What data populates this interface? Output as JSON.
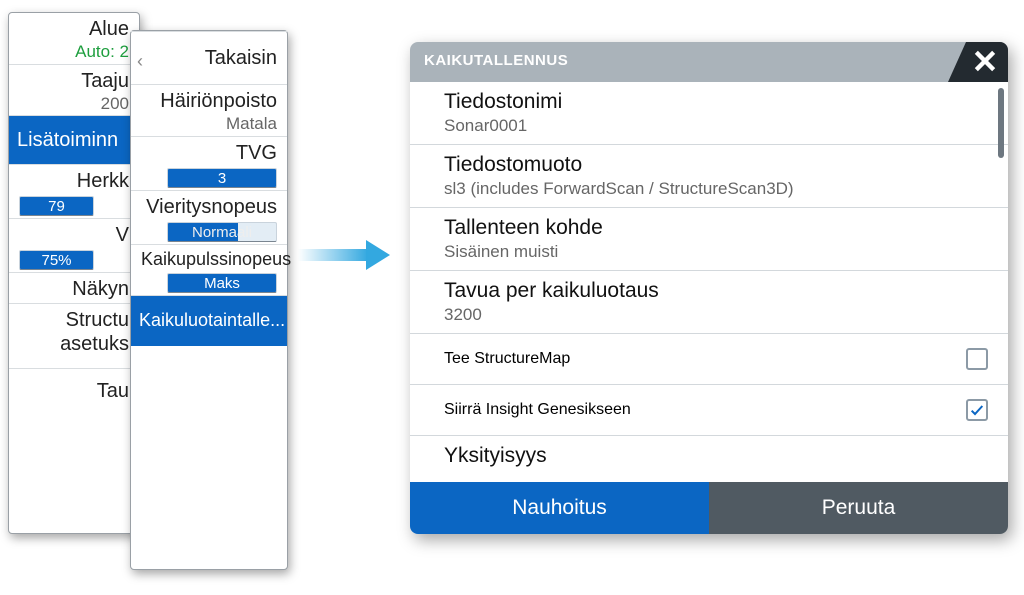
{
  "back_panel": {
    "alue": {
      "label": "Alue",
      "sub": "Auto: 2"
    },
    "taaju": {
      "label": "Taaju",
      "sub": "200"
    },
    "lisatoiminn": {
      "label": "Lisätoiminn"
    },
    "herkk": {
      "label": "Herkk",
      "chip": "79"
    },
    "v": {
      "label": "V",
      "chip": "75%"
    },
    "nakym": {
      "label": "Näkyn"
    },
    "struct": {
      "line1": "Structu",
      "line2": "asetuks"
    },
    "tau": {
      "label": "Tau"
    }
  },
  "front_panel": {
    "back": "Takaisin",
    "hairion": {
      "label": "Häiriönpoisto",
      "sub": "Matala"
    },
    "tvg": {
      "label": "TVG",
      "chip": "3"
    },
    "vieritys": {
      "label": "Vieritysnopeus",
      "chip": "Normaali"
    },
    "kaikupulssi": {
      "label": "Kaikupulssinopeus",
      "chip": "Maks"
    },
    "kaikuluot": {
      "label": "Kaikuluotaintalle..."
    }
  },
  "dialog": {
    "title": "KAIKUTALLENNUS",
    "rows": {
      "filename": {
        "label": "Tiedostonimi",
        "value": "Sonar0001"
      },
      "format": {
        "label": "Tiedostomuoto",
        "value": "sl3 (includes ForwardScan / StructureScan3D)"
      },
      "dest": {
        "label": "Tallenteen kohde",
        "value": "Sisäinen muisti"
      },
      "bytes": {
        "label": "Tavua per kaikuluotaus",
        "value": "3200"
      },
      "structmap": {
        "label": "Tee StructureMap"
      },
      "insight": {
        "label": "Siirrä Insight Genesikseen"
      },
      "privacy": {
        "label": "Yksityisyys"
      }
    },
    "record": "Nauhoitus",
    "cancel": "Peruuta"
  }
}
